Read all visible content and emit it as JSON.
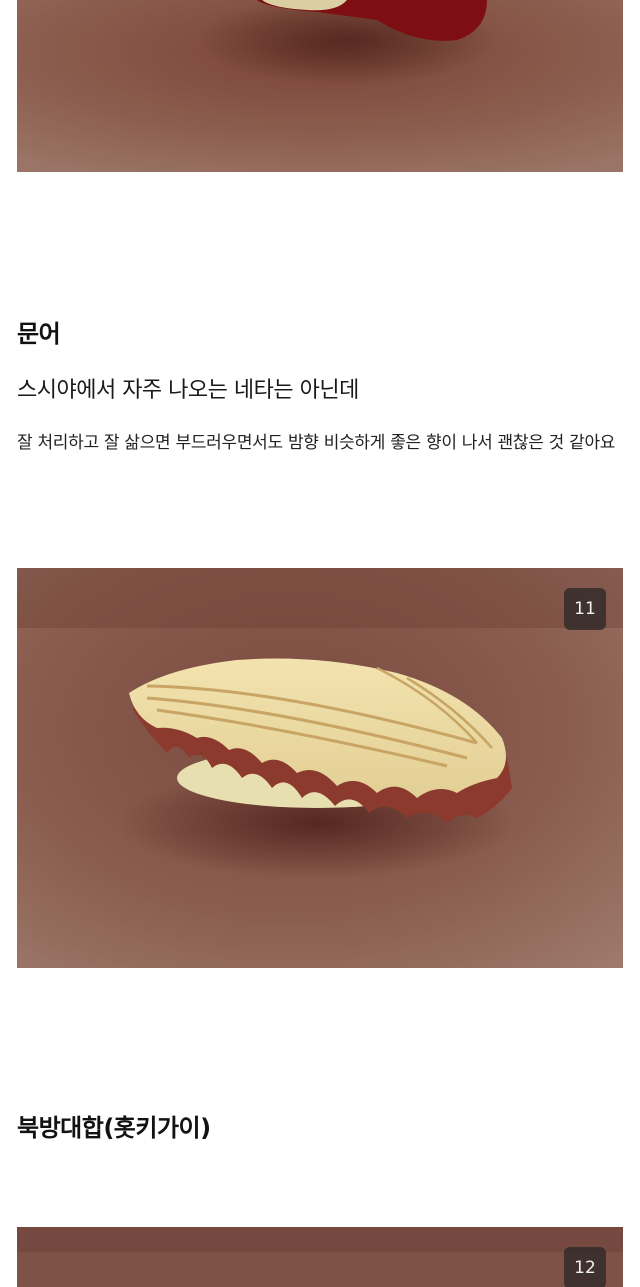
{
  "sections": {
    "octopus": {
      "title": "문어",
      "subtitle": "스시야에서 자주 나오는 네타는 아닌데",
      "description": "잘 처리하고 잘 삶으면 부드러우면서도 밤향 비슷하게 좋은 향이 나서 괜찮은 것 같아요",
      "image_counter": "11"
    },
    "surf_clam": {
      "title": "북방대합(홋키가이)",
      "image_counter": "12"
    }
  },
  "colors": {
    "table_surface": "#8a5a4c",
    "text_primary": "#111111"
  }
}
